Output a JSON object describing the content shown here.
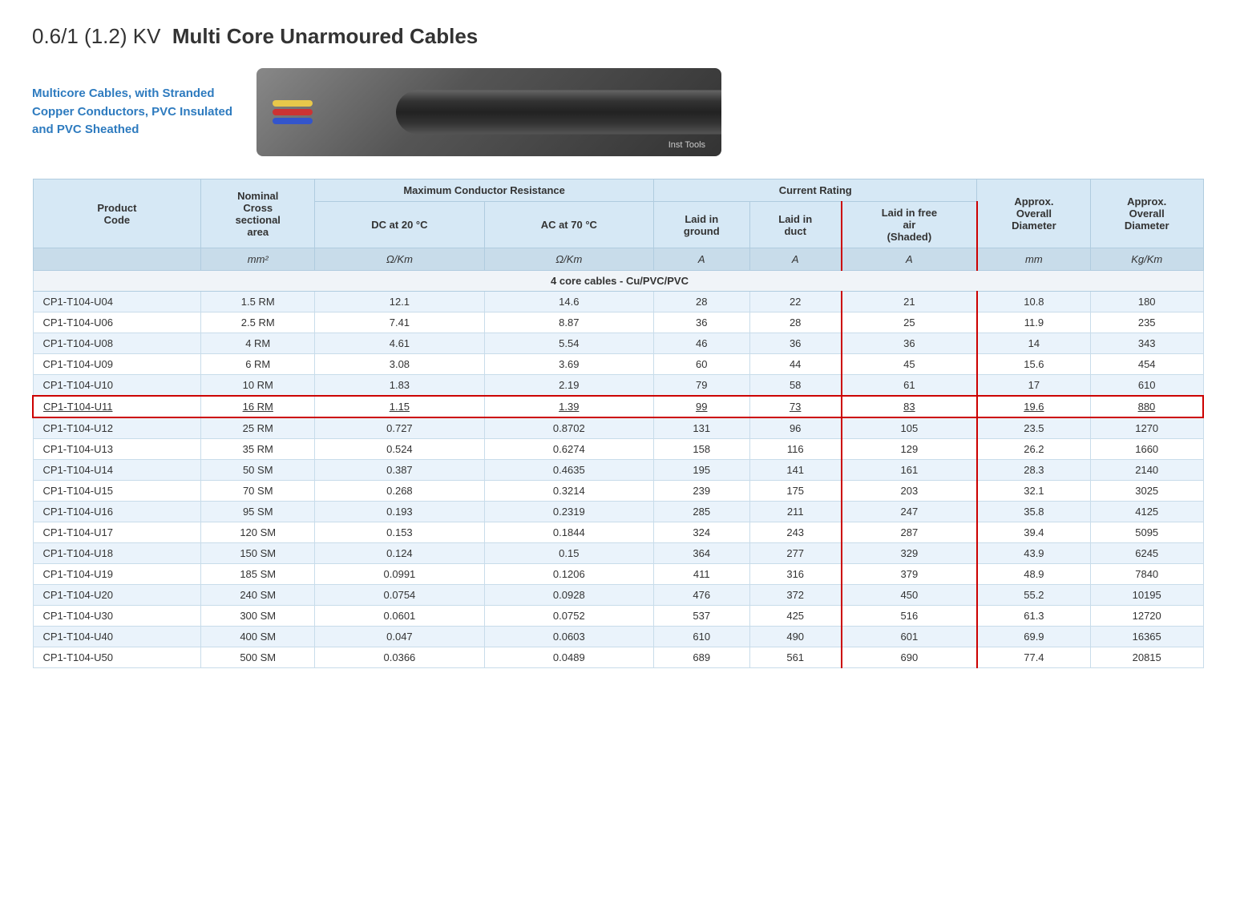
{
  "page": {
    "title_prefix": "0.6/1 (1.2) KV",
    "title_bold": "Multi Core Unarmoured Cables",
    "subtitle": "Multicore Cables, with Stranded\nCopper Conductors, PVC Insulated\nand PVC Sheathed",
    "cable_image_label": "Inst Tools"
  },
  "table": {
    "headers": {
      "product_code": "Product\nCode",
      "nominal_cross": "Nominal\nCross\nsectional\narea",
      "max_conductor": "Maximum Conductor Resistance",
      "dc_20": "DC at 20 °C",
      "ac_70": "AC at 70 °C",
      "current_rating": "Current Rating",
      "laid_in_ground": "Laid in\nground",
      "laid_in_duct": "Laid in\nduct",
      "laid_in_free_air": "Laid in free\nair\n(Shaded)",
      "approx_overall_diameter": "Approx.\nOverall\nDiameter",
      "approx_overall_weight": "Approx.\nOverall\nDiameter"
    },
    "units": {
      "nominal_cross": "mm²",
      "dc_20": "Ω/Km",
      "ac_70": "Ω/Km",
      "laid_in_ground": "A",
      "laid_in_duct": "A",
      "laid_in_free_air": "A",
      "approx_diameter": "mm",
      "approx_weight": "Kg/Km"
    },
    "section_header": "4 core cables - Cu/PVC/PVC",
    "rows": [
      {
        "code": "CP1-T104-U04",
        "nominal": "1.5 RM",
        "dc20": "12.1",
        "ac70": "14.6",
        "ground": "28",
        "duct": "22",
        "free_air": "21",
        "diameter": "10.8",
        "weight": "180",
        "highlighted": false
      },
      {
        "code": "CP1-T104-U06",
        "nominal": "2.5 RM",
        "dc20": "7.41",
        "ac70": "8.87",
        "ground": "36",
        "duct": "28",
        "free_air": "25",
        "diameter": "11.9",
        "weight": "235",
        "highlighted": false
      },
      {
        "code": "CP1-T104-U08",
        "nominal": "4 RM",
        "dc20": "4.61",
        "ac70": "5.54",
        "ground": "46",
        "duct": "36",
        "free_air": "36",
        "diameter": "14",
        "weight": "343",
        "highlighted": false
      },
      {
        "code": "CP1-T104-U09",
        "nominal": "6 RM",
        "dc20": "3.08",
        "ac70": "3.69",
        "ground": "60",
        "duct": "44",
        "free_air": "45",
        "diameter": "15.6",
        "weight": "454",
        "highlighted": false
      },
      {
        "code": "CP1-T104-U10",
        "nominal": "10 RM",
        "dc20": "1.83",
        "ac70": "2.19",
        "ground": "79",
        "duct": "58",
        "free_air": "61",
        "diameter": "17",
        "weight": "610",
        "highlighted": false
      },
      {
        "code": "CP1-T104-U11",
        "nominal": "16 RM",
        "dc20": "1.15",
        "ac70": "1.39",
        "ground": "99",
        "duct": "73",
        "free_air": "83",
        "diameter": "19.6",
        "weight": "880",
        "highlighted": true
      },
      {
        "code": "CP1-T104-U12",
        "nominal": "25 RM",
        "dc20": "0.727",
        "ac70": "0.8702",
        "ground": "131",
        "duct": "96",
        "free_air": "105",
        "diameter": "23.5",
        "weight": "1270",
        "highlighted": false
      },
      {
        "code": "CP1-T104-U13",
        "nominal": "35 RM",
        "dc20": "0.524",
        "ac70": "0.6274",
        "ground": "158",
        "duct": "116",
        "free_air": "129",
        "diameter": "26.2",
        "weight": "1660",
        "highlighted": false
      },
      {
        "code": "CP1-T104-U14",
        "nominal": "50 SM",
        "dc20": "0.387",
        "ac70": "0.4635",
        "ground": "195",
        "duct": "141",
        "free_air": "161",
        "diameter": "28.3",
        "weight": "2140",
        "highlighted": false
      },
      {
        "code": "CP1-T104-U15",
        "nominal": "70 SM",
        "dc20": "0.268",
        "ac70": "0.3214",
        "ground": "239",
        "duct": "175",
        "free_air": "203",
        "diameter": "32.1",
        "weight": "3025",
        "highlighted": false
      },
      {
        "code": "CP1-T104-U16",
        "nominal": "95 SM",
        "dc20": "0.193",
        "ac70": "0.2319",
        "ground": "285",
        "duct": "211",
        "free_air": "247",
        "diameter": "35.8",
        "weight": "4125",
        "highlighted": false
      },
      {
        "code": "CP1-T104-U17",
        "nominal": "120 SM",
        "dc20": "0.153",
        "ac70": "0.1844",
        "ground": "324",
        "duct": "243",
        "free_air": "287",
        "diameter": "39.4",
        "weight": "5095",
        "highlighted": false
      },
      {
        "code": "CP1-T104-U18",
        "nominal": "150 SM",
        "dc20": "0.124",
        "ac70": "0.15",
        "ground": "364",
        "duct": "277",
        "free_air": "329",
        "diameter": "43.9",
        "weight": "6245",
        "highlighted": false
      },
      {
        "code": "CP1-T104-U19",
        "nominal": "185 SM",
        "dc20": "0.0991",
        "ac70": "0.1206",
        "ground": "411",
        "duct": "316",
        "free_air": "379",
        "diameter": "48.9",
        "weight": "7840",
        "highlighted": false
      },
      {
        "code": "CP1-T104-U20",
        "nominal": "240 SM",
        "dc20": "0.0754",
        "ac70": "0.0928",
        "ground": "476",
        "duct": "372",
        "free_air": "450",
        "diameter": "55.2",
        "weight": "10195",
        "highlighted": false
      },
      {
        "code": "CP1-T104-U30",
        "nominal": "300 SM",
        "dc20": "0.0601",
        "ac70": "0.0752",
        "ground": "537",
        "duct": "425",
        "free_air": "516",
        "diameter": "61.3",
        "weight": "12720",
        "highlighted": false
      },
      {
        "code": "CP1-T104-U40",
        "nominal": "400 SM",
        "dc20": "0.047",
        "ac70": "0.0603",
        "ground": "610",
        "duct": "490",
        "free_air": "601",
        "diameter": "69.9",
        "weight": "16365",
        "highlighted": false
      },
      {
        "code": "CP1-T104-U50",
        "nominal": "500 SM",
        "dc20": "0.0366",
        "ac70": "0.0489",
        "ground": "689",
        "duct": "561",
        "free_air": "690",
        "diameter": "77.4",
        "weight": "20815",
        "highlighted": false
      }
    ]
  }
}
